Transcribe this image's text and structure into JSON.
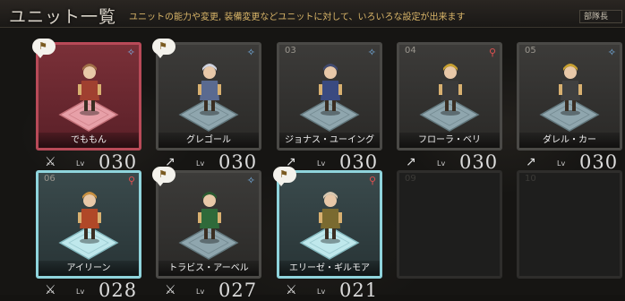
{
  "header": {
    "title": "ユニット一覧",
    "subtitle": "ユニットの能力や変更, 装備変更などユニットに対して、いろいろな設定が出来ます",
    "sort_label": "部隊長"
  },
  "lv_label": "Lv",
  "colors": {
    "selected_border": "#b84a58",
    "cyan_border": "#8fd4dc",
    "level_text": "#dcdcdc",
    "subtitle": "#d8b468"
  },
  "units": [
    {
      "slot": "",
      "name": "でももん",
      "level": "030",
      "flag": true,
      "class_icon": "sparkle-icon",
      "class_glyph": "✧",
      "class_color": "#7ab8f0",
      "weapon_icon": "sword-icon",
      "weapon_glyph": "⚔",
      "style": "sel"
    },
    {
      "slot": "",
      "name": "グレゴール",
      "level": "030",
      "flag": true,
      "class_icon": "sparkle-icon",
      "class_glyph": "✧",
      "class_color": "#7ab8f0",
      "weapon_icon": "spear-icon",
      "weapon_glyph": "↗",
      "style": "filled"
    },
    {
      "slot": "03",
      "name": "ジョナス・ユーイング",
      "level": "030",
      "flag": false,
      "class_icon": "sparkle-icon",
      "class_glyph": "✧",
      "class_color": "#7ab8f0",
      "weapon_icon": "spear-icon",
      "weapon_glyph": "↗",
      "style": "filled"
    },
    {
      "slot": "04",
      "name": "フローラ・ベリ",
      "level": "030",
      "flag": false,
      "class_icon": "figure-icon",
      "class_glyph": "⚲",
      "class_color": "#e05050",
      "weapon_icon": "spear-icon",
      "weapon_glyph": "↗",
      "style": "filled"
    },
    {
      "slot": "05",
      "name": "ダレル・カー",
      "level": "030",
      "flag": false,
      "class_icon": "sparkle-icon",
      "class_glyph": "✧",
      "class_color": "#7ab8f0",
      "weapon_icon": "spear-icon",
      "weapon_glyph": "↗",
      "style": "filled"
    },
    {
      "slot": "06",
      "name": "アイリーン",
      "level": "028",
      "flag": false,
      "class_icon": "figure-icon",
      "class_glyph": "⚲",
      "class_color": "#e05050",
      "weapon_icon": "sword-icon",
      "weapon_glyph": "⚔",
      "style": "cyan"
    },
    {
      "slot": "",
      "name": "トラビス・アーベル",
      "level": "027",
      "flag": true,
      "class_icon": "sparkle-icon",
      "class_glyph": "✧",
      "class_color": "#7ab8f0",
      "weapon_icon": "sword-icon",
      "weapon_glyph": "⚔",
      "style": "filled"
    },
    {
      "slot": "",
      "name": "エリーゼ・ギルモア",
      "level": "021",
      "flag": true,
      "class_icon": "figure-icon",
      "class_glyph": "⚲",
      "class_color": "#e05050",
      "weapon_icon": "sword-icon",
      "weapon_glyph": "⚔",
      "style": "cyan"
    },
    {
      "slot": "09",
      "name": "",
      "level": "",
      "flag": false,
      "style": "empty"
    },
    {
      "slot": "10",
      "name": "",
      "level": "",
      "flag": false,
      "style": "empty"
    }
  ]
}
